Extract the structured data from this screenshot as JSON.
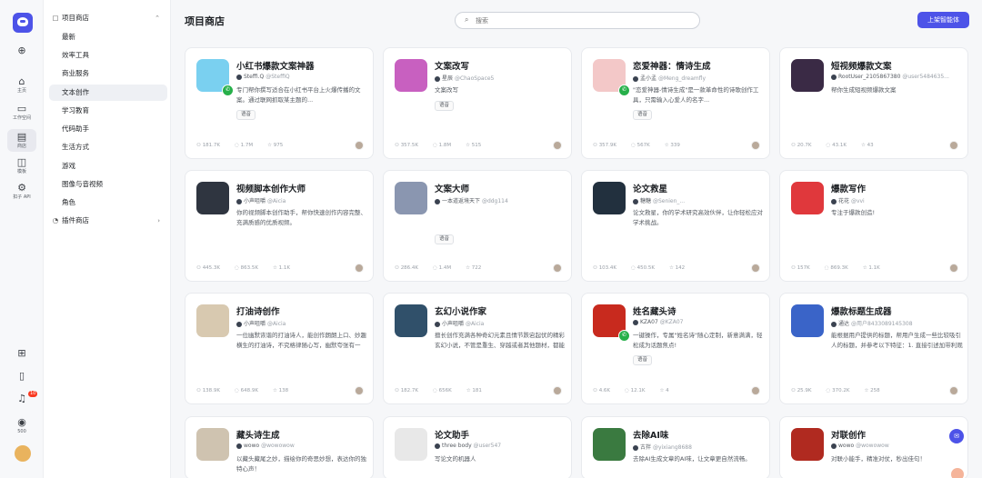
{
  "rail": {
    "items": [
      {
        "icon": "plus-icon",
        "glyph": "⊕",
        "label": ""
      },
      {
        "icon": "home-icon",
        "glyph": "⌂",
        "label": "主页"
      },
      {
        "icon": "folder-icon",
        "glyph": "▭",
        "label": "工作空间"
      },
      {
        "icon": "store-icon",
        "glyph": "▤",
        "label": "商店"
      },
      {
        "icon": "template-icon",
        "glyph": "◫",
        "label": "模板"
      },
      {
        "icon": "api-icon",
        "glyph": "⚙",
        "label": "扣子 API"
      },
      {
        "icon": "apps-icon",
        "glyph": "⊞",
        "label": ""
      },
      {
        "icon": "doc-icon",
        "glyph": "▯",
        "label": ""
      },
      {
        "icon": "bell-icon",
        "glyph": "♫",
        "label": ""
      },
      {
        "icon": "points-icon",
        "glyph": "◉",
        "label": "500"
      }
    ],
    "notification_count": "10"
  },
  "sidebar": {
    "project_store": "项目商店",
    "items": [
      "最新",
      "效率工具",
      "商业服务",
      "文本创作",
      "学习教育",
      "代码助手",
      "生活方式",
      "游戏",
      "图像与音视频",
      "角色"
    ],
    "plugin_store": "插件商店"
  },
  "header": {
    "title": "项目商店",
    "search_placeholder": "搜索",
    "publish_label": "上架智能体"
  },
  "cards": [
    {
      "name": "小红书爆款文案神器",
      "author": "Steffi.Q",
      "handle": "@SteffiQ",
      "desc": "专门帮你撰写适合在小红书平台上火爆传播的文案。通过联网抓取某主题的...",
      "tag": "语音",
      "stats": [
        "181.7K",
        "1.7M",
        "975"
      ],
      "color": "#7ad0f0",
      "wechat": true
    },
    {
      "name": "文案改写",
      "author": "星辰",
      "handle": "@ChaoSpace5",
      "desc": "文案改写",
      "tag": "语音",
      "stats": [
        "357.5K",
        "1.8M",
        "515"
      ],
      "color": "#c860c0",
      "wechat": false
    },
    {
      "name": "恋爱神器：情诗生成",
      "author": "孟小孟",
      "handle": "@Meng_dreamfly",
      "desc": "\"恋爱神器-情诗生成\"是一款革命性的诗歌创作工具，只需输入心爱人的名字...",
      "tag": "语音",
      "stats": [
        "357.9K",
        "567K",
        "339"
      ],
      "color": "#f3c8c8",
      "wechat": true
    },
    {
      "name": "短视频爆款文案",
      "author": "RootUser_2105867380",
      "handle": "@user5484635...",
      "desc": "帮你生成短视频爆款文案",
      "tag": "",
      "stats": [
        "20.7K",
        "43.1K",
        "43"
      ],
      "color": "#3a2a45",
      "wechat": false
    },
    {
      "name": "视频脚本创作大师",
      "author": "小声咀嚼",
      "handle": "@Aicia",
      "desc": "你的视频脚本创作助手，帮你快速创作内容完整、充满质感的优质视频。",
      "tag": "",
      "stats": [
        "445.3K",
        "863.5K",
        "1.1K"
      ],
      "color": "#2f3540",
      "wechat": false
    },
    {
      "name": "文案大师",
      "author": "一本道返境天下",
      "handle": "@ddg114",
      "desc": "",
      "tag": "语音",
      "stats": [
        "286.4K",
        "1.4M",
        "722"
      ],
      "color": "#8a96b0",
      "wechat": false
    },
    {
      "name": "论文救星",
      "author": "糖糖",
      "handle": "@Senien_...",
      "desc": "论文救星，你的学术研究高效伙伴，让你轻松应对学术挑战。",
      "tag": "",
      "stats": [
        "103.4K",
        "450.5K",
        "142"
      ],
      "color": "#22303e",
      "wechat": false
    },
    {
      "name": "爆款写作",
      "author": "花花",
      "handle": "@vvi",
      "desc": "专注于爆款创造!",
      "tag": "",
      "stats": [
        "157K",
        "869.3K",
        "1.1K"
      ],
      "color": "#e0383c",
      "wechat": false
    },
    {
      "name": "打油诗创作",
      "author": "小声咀嚼",
      "handle": "@Aicia",
      "desc": "一位幽默诙谐的打油诗人，能创作朗朗上口、妙趣横生的打油诗，不究格律随心写，幽默夸张有一套。",
      "tag": "",
      "stats": [
        "138.9K",
        "648.9K",
        "138"
      ],
      "color": "#d8c9b0",
      "wechat": false
    },
    {
      "name": "玄幻小说作家",
      "author": "小声咀嚼",
      "handle": "@Aicia",
      "desc": "擅长创作充满各种奇幻元素且情节跌宕起伏的精彩玄幻小说，不管是重生、穿越或者其他题材，都能写。",
      "tag": "",
      "stats": [
        "182.7K",
        "656K",
        "181"
      ],
      "color": "#30506a",
      "wechat": false
    },
    {
      "name": "姓名藏头诗",
      "author": "KZA07",
      "handle": "@KZA07",
      "desc": "一键操作，专属\"姓名诗\"随心定制，新意满满，轻松成为话题焦点!",
      "tag": "语音",
      "stats": [
        "4.6K",
        "12.1K",
        "4"
      ],
      "color": "#c82a1e",
      "wechat": true
    },
    {
      "name": "爆款标题生成器",
      "author": "通达",
      "handle": "@用户8433089145308",
      "desc": "能根据用户提供的标题，帮用户生成一些比较吸引人的标题，并参考以下特征：1. 直接引述加带利观点：特征：...",
      "tag": "",
      "stats": [
        "25.9K",
        "370.2K",
        "258"
      ],
      "color": "#3a64c8",
      "wechat": false
    },
    {
      "name": "藏头诗生成",
      "author": "wowo",
      "handle": "@wowowow",
      "desc": "以藏头藏尾之妙，描绘你的奇思妙想，表达你的独特心声！",
      "tag": "",
      "stats": [
        "",
        "",
        ""
      ],
      "color": "#cfc3b0",
      "wechat": false
    },
    {
      "name": "论文助手",
      "author": "three body",
      "handle": "@user547",
      "desc": "写论文的机器人",
      "tag": "",
      "stats": [
        "",
        "",
        ""
      ],
      "color": "#e8e8e8",
      "wechat": false
    },
    {
      "name": "去除AI味",
      "author": "古拌",
      "handle": "@yixiang8688",
      "desc": "去除AI生成文章的AI味，让文章更自然流畅。",
      "tag": "",
      "stats": [
        "",
        "",
        ""
      ],
      "color": "#3a7a40",
      "wechat": false
    },
    {
      "name": "对联创作",
      "author": "wowo",
      "handle": "@wowowow",
      "desc": "对联小能手，精准对仗，秒出佳句！",
      "tag": "",
      "stats": [
        "",
        "",
        ""
      ],
      "color": "#b02a20",
      "wechat": false
    }
  ]
}
